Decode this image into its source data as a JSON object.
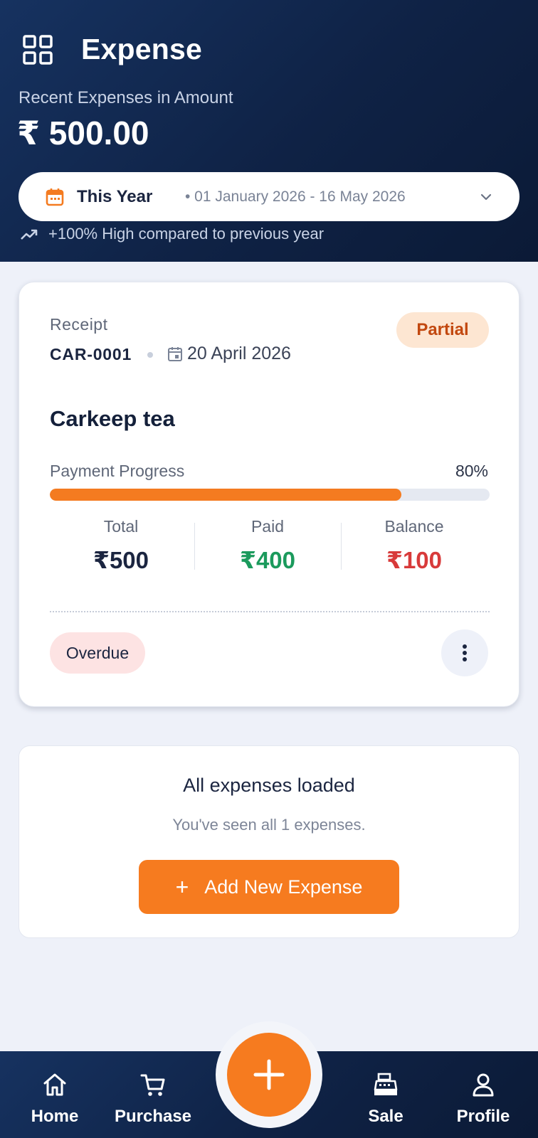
{
  "header": {
    "title": "Expense",
    "subtitle": "Recent Expenses in Amount",
    "amount": "₹ 500.00",
    "period": {
      "label": "This Year",
      "range": "• 01 January 2026 - 16 May 2026"
    },
    "trend_text": "+100% High compared to previous year"
  },
  "expense_card": {
    "doc_type": "Receipt",
    "doc_number": "CAR-0001",
    "date": "20 April 2026",
    "status": "Partial",
    "vendor": "Carkeep tea",
    "progress_label": "Payment Progress",
    "progress_text": "80%",
    "progress_percent": 80,
    "stats": {
      "total_label": "Total",
      "total_value": "₹500",
      "paid_label": "Paid",
      "paid_value": "₹400",
      "balance_label": "Balance",
      "balance_value": "₹100"
    },
    "due_status": "Overdue"
  },
  "end_of_list": {
    "title": "All expenses loaded",
    "subtitle": "You've seen all 1 expenses.",
    "button_label": "Add New Expense"
  },
  "bottom_nav": {
    "items": [
      {
        "label": "Home",
        "icon": "home-icon"
      },
      {
        "label": "Purchase",
        "icon": "cart-icon"
      },
      {
        "label": "Sale",
        "icon": "cash-register-icon"
      },
      {
        "label": "Profile",
        "icon": "user-icon"
      }
    ],
    "fab_icon": "plus-icon"
  },
  "colors": {
    "accent": "#f67b1f",
    "header_bg": "#0f2245",
    "paid": "#1b9a5c",
    "balance": "#d83a3a",
    "partial_bg": "#fde6d2",
    "overdue_bg": "#fde3e3"
  }
}
